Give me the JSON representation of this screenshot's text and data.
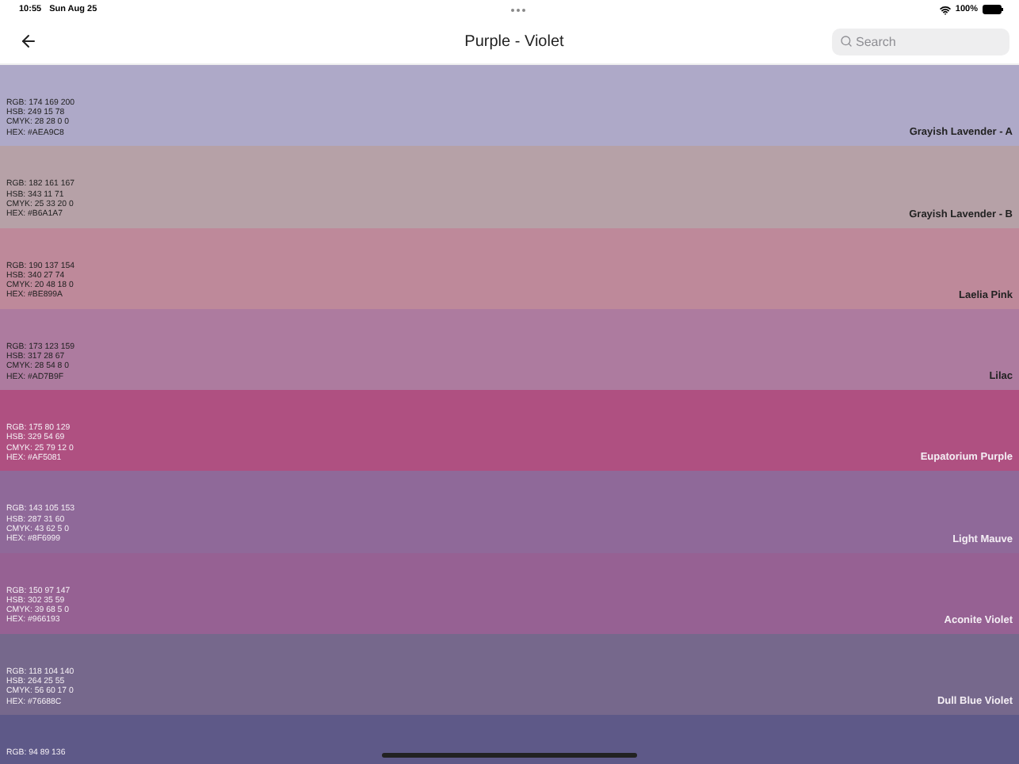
{
  "status_bar": {
    "time": "10:55",
    "date": "Sun Aug 25",
    "battery": "100%"
  },
  "header": {
    "title": "Purple - Violet",
    "search": {
      "placeholder": "Search"
    }
  },
  "swatches": [
    {
      "name": "Grayish Lavender - A",
      "color": "#aea9c8",
      "lines": [
        "RGB: 174 169 200",
        "HSB: 249 15 78",
        "CMYK: 28 28 0 0",
        "HEX: #AEA9C8"
      ]
    },
    {
      "name": "Grayish Lavender - B",
      "color": "#b6a1a7",
      "lines": [
        "RGB: 182 161 167",
        "HSB: 343 11 71",
        "CMYK: 25 33 20 0",
        "HEX: #B6A1A7"
      ]
    },
    {
      "name": "Laelia Pink",
      "color": "#be899a",
      "lines": [
        "RGB: 190 137 154",
        "HSB: 340 27 74",
        "CMYK: 20 48 18 0",
        "HEX: #BE899A"
      ]
    },
    {
      "name": "Lilac",
      "color": "#ad7b9f",
      "lines": [
        "RGB: 173 123 159",
        "HSB: 317 28 67",
        "CMYK: 28 54 8 0",
        "HEX: #AD7B9F"
      ]
    },
    {
      "name": "Eupatorium Purple",
      "color": "#af5081",
      "lines": [
        "RGB: 175 80 129",
        "HSB: 329 54 69",
        "CMYK: 25 79 12 0",
        "HEX: #AF5081"
      ]
    },
    {
      "name": "Light Mauve",
      "color": "#8f6999",
      "lines": [
        "RGB: 143 105 153",
        "HSB: 287 31 60",
        "CMYK: 43 62 5 0",
        "HEX: #8F6999"
      ]
    },
    {
      "name": "Aconite Violet",
      "color": "#966193",
      "lines": [
        "RGB: 150 97 147",
        "HSB: 302 35 59",
        "CMYK: 39 68 5 0",
        "HEX: #966193"
      ]
    },
    {
      "name": "Dull Blue Violet",
      "color": "#76688c",
      "lines": [
        "RGB: 118 104 140",
        "HSB: 264 25 55",
        "CMYK: 56 60 17 0",
        "HEX: #76688C"
      ]
    },
    {
      "color": "#5e5988",
      "lines": [
        "RGB: 94 89 136"
      ]
    }
  ]
}
